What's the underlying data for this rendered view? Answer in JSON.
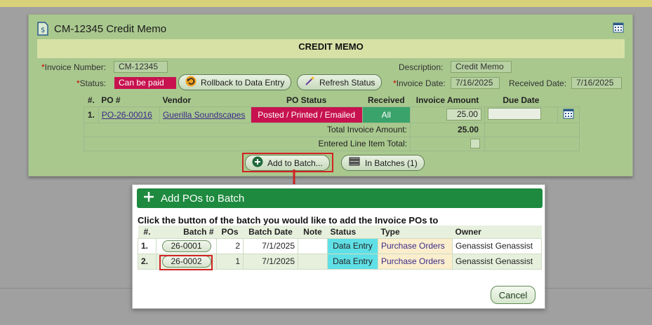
{
  "memo": {
    "title": "CM-12345 Credit Memo",
    "banner": "CREDIT MEMO",
    "invoice_number_label": "Invoice Number:",
    "invoice_number": "CM-12345",
    "status_label": "Status:",
    "status_value": "Can be paid",
    "rollback_label": "Rollback to Data Entry",
    "refresh_label": "Refresh Status",
    "description_label": "Description:",
    "description": "Credit Memo",
    "invoice_date_label": "Invoice Date:",
    "invoice_date": "7/16/2025",
    "received_date_label": "Received Date:",
    "received_date": "7/16/2025",
    "table": {
      "headers": [
        "#.",
        "PO #",
        "Vendor",
        "PO Status",
        "Received",
        "Invoice Amount",
        "Due Date"
      ],
      "rows": [
        {
          "num": "1.",
          "po": "PO-26-00016",
          "vendor": "Guerilla Soundscapes",
          "po_status": "Posted / Printed / Emailed",
          "received": "All",
          "amount": "25.00",
          "due": ""
        }
      ]
    },
    "total_label": "Total Invoice Amount:",
    "total_value": "25.00",
    "entered_label": "Entered Line Item Total:",
    "add_batch_label": "Add to Batch...",
    "in_batches_label": "In Batches (1)"
  },
  "dialog": {
    "title": "Add POs to Batch",
    "instruction": "Click the button of the batch you would like to add the Invoice POs to",
    "headers": [
      "#.",
      "Batch #",
      "POs",
      "Batch Date",
      "Note",
      "Status",
      "Type",
      "Owner"
    ],
    "rows": [
      {
        "num": "1.",
        "batch": "26-0001",
        "pos": "2",
        "date": "7/1/2025",
        "note": "",
        "status": "Data Entry",
        "type": "Purchase Orders",
        "owner": "Genassist Genassist"
      },
      {
        "num": "2.",
        "batch": "26-0002",
        "pos": "1",
        "date": "7/1/2025",
        "note": "",
        "status": "Data Entry",
        "type": "Purchase Orders",
        "owner": "Genassist Genassist"
      }
    ],
    "cancel_label": "Cancel"
  },
  "colors": {
    "accent_green": "#1e8a3f",
    "status_red": "#c7124f",
    "highlight": "#d22222",
    "data_entry": "#5fe0e6"
  }
}
